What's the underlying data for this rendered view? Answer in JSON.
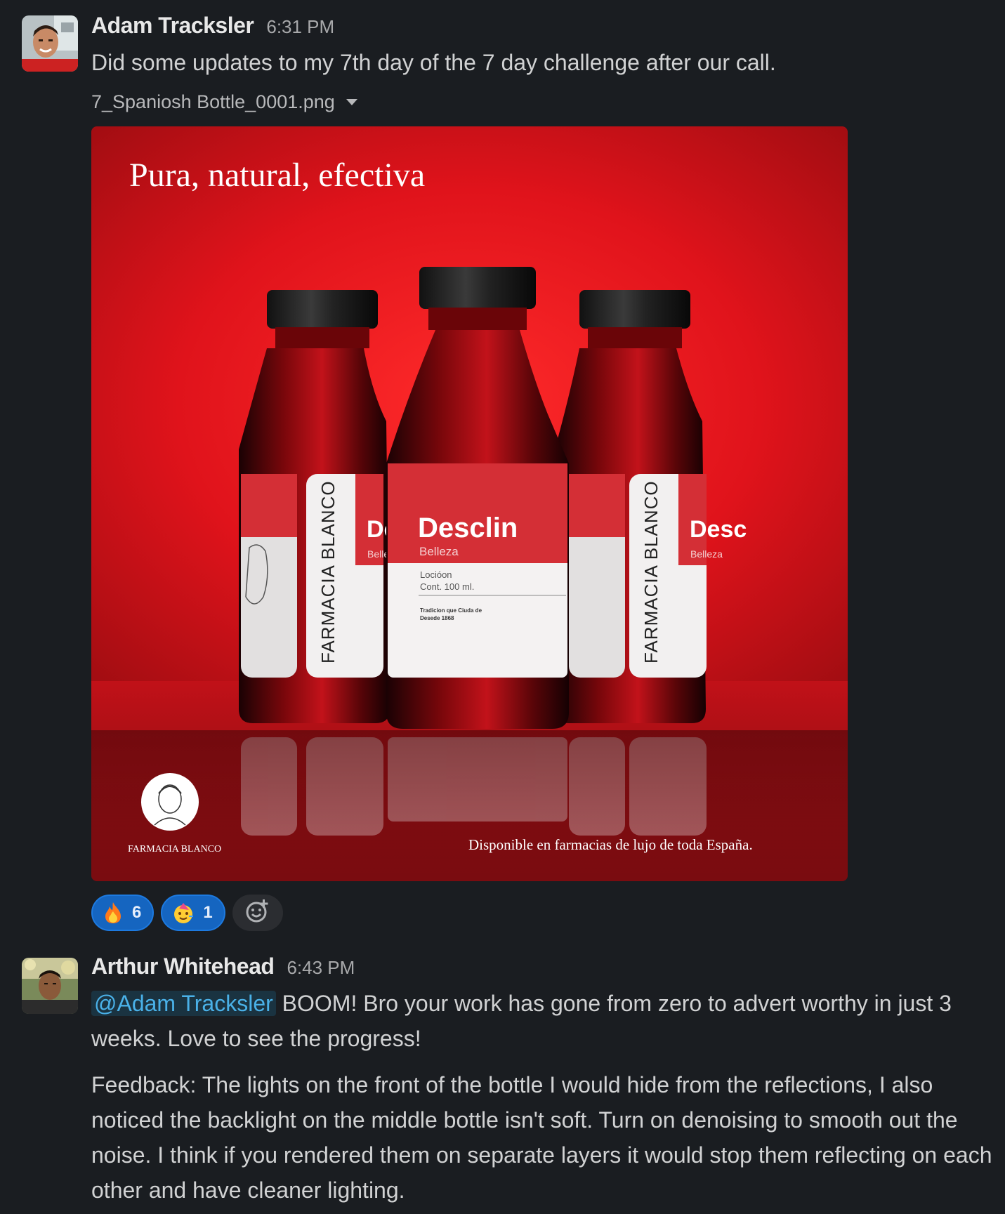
{
  "messages": [
    {
      "author": "Adam Tracksler",
      "time": "6:31 PM",
      "text": "Did some updates to my 7th day of the 7 day challenge after our call.",
      "attachment": {
        "filename": "7_Spaniosh Bottle_0001.png",
        "headline": "Pura, natural, efectiva",
        "bottle_brand": "Desclin",
        "bottle_subtitle": "Belleza",
        "bottle_line1": "Locióon",
        "bottle_line2": "Cont. 100 ml.",
        "bottle_small1": "Tradicion que Ciuda de",
        "bottle_small2": "Desede 1868",
        "side_label": "FARMACIA BLANCO",
        "side_brand_partial": "De",
        "side_brand_partial_right": "Desc",
        "side_subtitle_partial": "Belle",
        "side_subtitle_partial_right": "Belleza",
        "logo_text": "FARMACIA BLANCO",
        "tagline": "Disponible en farmacias de lujo de toda España."
      },
      "reactions": [
        {
          "emoji": "fire-emoji",
          "count": "6"
        },
        {
          "emoji": "partying-face-emoji",
          "count": "1"
        }
      ]
    },
    {
      "author": "Arthur Whitehead",
      "time": "6:43 PM",
      "mention": "@Adam Tracksler",
      "text1": " BOOM! Bro your work has gone from zero to advert worthy in just 3 weeks. Love to see the progress!",
      "text2": "Feedback: The lights on the front of the bottle I would hide from the reflections, I also noticed the backlight on the middle bottle isn't soft. Turn on denoising to smooth out the noise. I think if you rendered them on separate layers it would stop them reflecting on each other and have cleaner lighting."
    }
  ],
  "colors": {
    "background": "#1a1d21",
    "reaction_bg": "#1565c0",
    "mention": "#4ab1e8",
    "poster_red": "#e3141c"
  }
}
